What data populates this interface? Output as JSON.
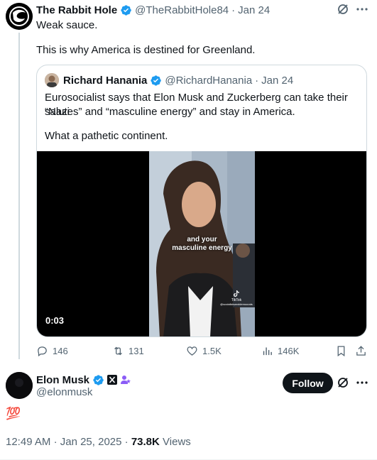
{
  "quoting_tweet": {
    "author_name": "The Rabbit Hole",
    "handle": "@TheRabbitHole84",
    "date_sep": "·",
    "date": "Jan 24",
    "line1": "Weak sauce.",
    "line2": "This is why America is destined for Greenland."
  },
  "quoted_tweet": {
    "author_name": "Richard Hanania",
    "handle": "@RichardHanania",
    "date_sep": "·",
    "date": "Jan 24",
    "text_line1": "Eurosocialist says that Elon Musk and Zuckerberg can take their “Nazi",
    "text_line2": "salutes” and “masculine energy” and stay in America.",
    "text_line3": "What a pathetic continent.",
    "video": {
      "caption_line1": "and your",
      "caption_line2": "masculine energy",
      "duration": "0:03",
      "watermark": "TikTok",
      "watermark_handle": "@socialistsanddemocrats"
    }
  },
  "actions": {
    "replies": "146",
    "reposts": "131",
    "likes": "1.5K",
    "views": "146K"
  },
  "main_tweet": {
    "author_name": "Elon Musk",
    "handle": "@elonmusk",
    "follow_label": "Follow",
    "text": "💯",
    "time": "12:49 AM",
    "sep": "·",
    "date": "Jan 25, 2025",
    "views_count": "73.8K",
    "views_label": "Views"
  },
  "colors": {
    "verified_blue": "#1d9bf0",
    "muted": "#536471",
    "border": "#cfd9de",
    "affiliate_purple": "#8b5cf6"
  },
  "icons": [
    "verified-badge-icon",
    "grok-icon",
    "more-icon",
    "reply-icon",
    "repost-icon",
    "like-icon",
    "views-icon",
    "bookmark-icon",
    "share-icon",
    "x-logo-icon",
    "affiliate-icon"
  ]
}
